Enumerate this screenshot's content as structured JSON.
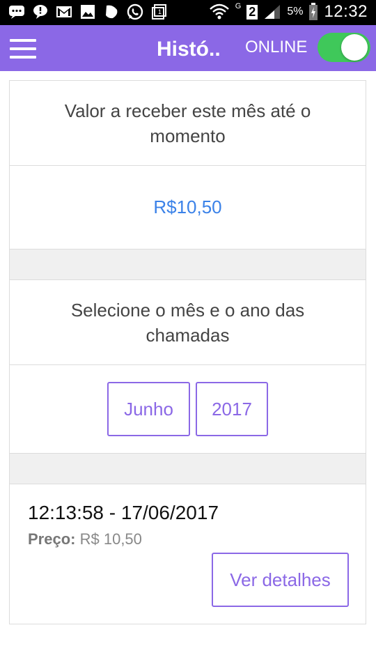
{
  "status_bar": {
    "battery_pct": "5%",
    "time": "12:32",
    "sim_number": "2",
    "network_letter": "G"
  },
  "app_bar": {
    "title": "Histó..",
    "online_label": "ONLINE",
    "online_toggle": true
  },
  "summary": {
    "label": "Valor a receber este mês até o momento",
    "value": "R$10,50"
  },
  "filter": {
    "label": "Selecione o mês e o ano das chamadas",
    "month": "Junho",
    "year": "2017"
  },
  "calls": [
    {
      "datetime": "12:13:58 - 17/06/2017",
      "price_label": "Preço:",
      "price_value": "R$ 10,50",
      "details_label": "Ver detalhes"
    }
  ],
  "colors": {
    "accent": "#8b68e6",
    "value_blue": "#3b82e8",
    "toggle_on": "#3fc85a"
  }
}
